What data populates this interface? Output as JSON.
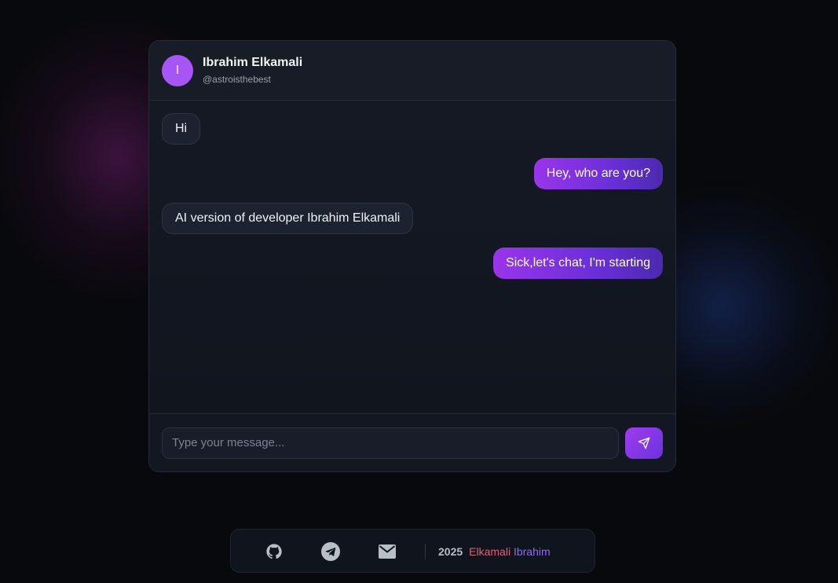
{
  "header": {
    "avatar_letter": "I",
    "name": "Ibrahim Elkamali",
    "handle": "@astroisthebest"
  },
  "messages": [
    {
      "direction": "incoming",
      "text": "Hi"
    },
    {
      "direction": "outgoing",
      "text": "Hey, who are you?"
    },
    {
      "direction": "incoming",
      "text": "AI version of developer Ibrahim Elkamali"
    },
    {
      "direction": "outgoing",
      "text": "Sick,let's chat, I'm starting"
    }
  ],
  "composer": {
    "placeholder": "Type your message...",
    "value": "",
    "send_icon": "send-icon"
  },
  "footer": {
    "icons": [
      "github-icon",
      "telegram-icon",
      "mail-icon"
    ],
    "year": "2025",
    "name_first": "Elkamali",
    "name_last": "Ibrahim"
  },
  "colors": {
    "accent_purple": "#a855f7",
    "outgoing_gradient_start": "#9a35ea",
    "outgoing_gradient_end": "#4b2ab0",
    "footer_name_first": "#e0607a",
    "footer_name_last": "#8a6df0"
  }
}
